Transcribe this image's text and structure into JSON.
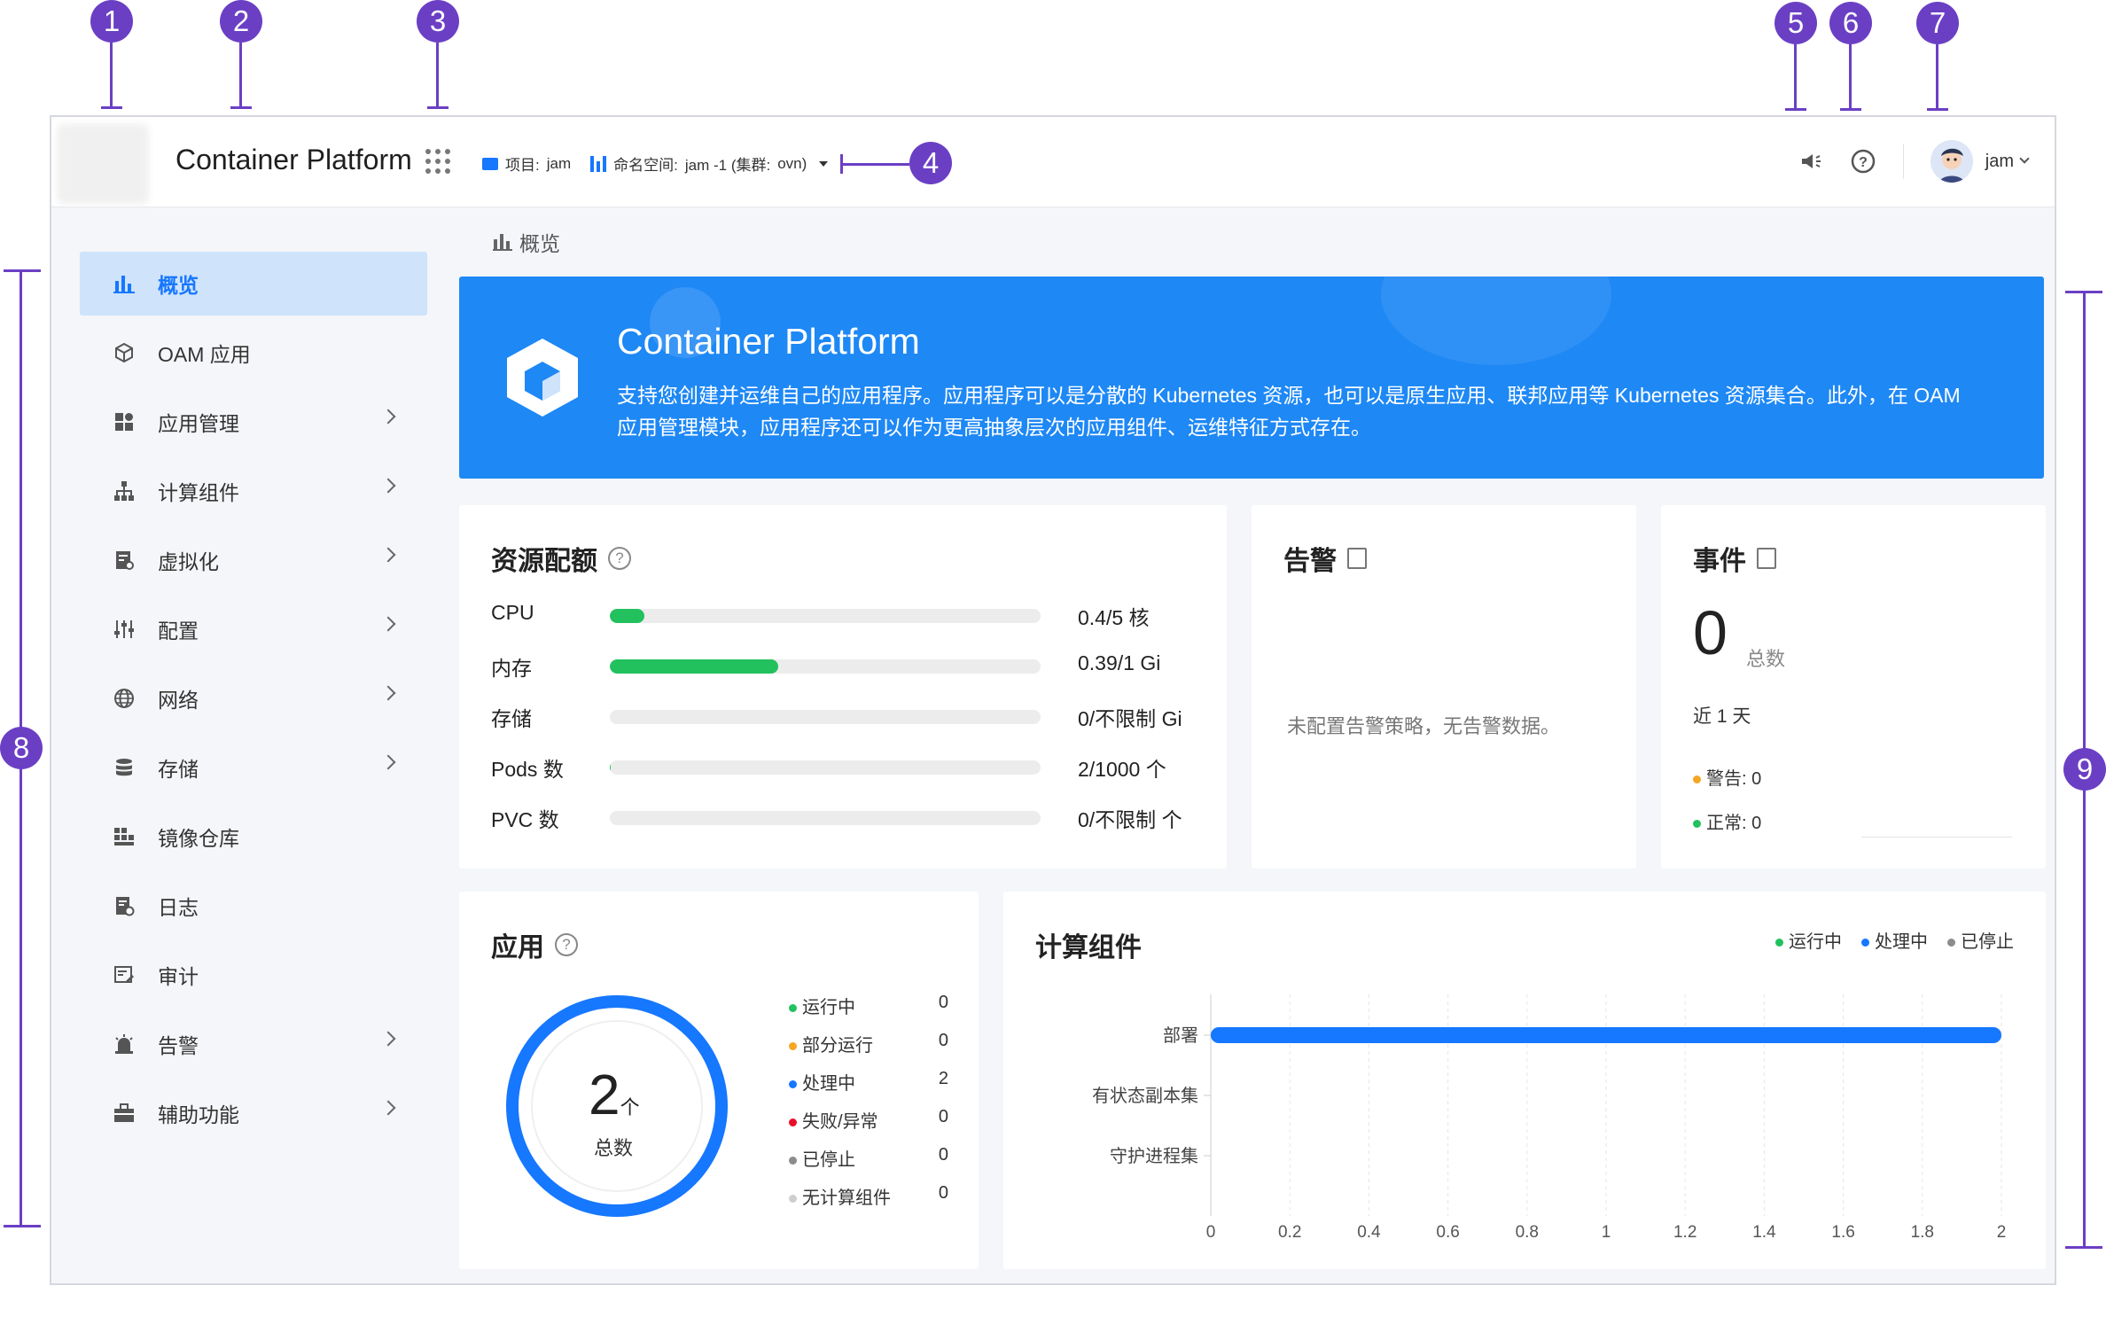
{
  "annotations": [
    "1",
    "2",
    "3",
    "4",
    "5",
    "6",
    "7",
    "8",
    "9"
  ],
  "header": {
    "brand": "Container Platform",
    "project_label": "项目:",
    "project_value": "jam",
    "namespace_label": "命名空间:",
    "namespace_value": "jam -1 (集群:",
    "cluster_value": "ovn)",
    "user": "jam"
  },
  "sidebar": {
    "items": [
      {
        "label": "概览",
        "icon": "chart-bar-icon"
      },
      {
        "label": "OAM 应用",
        "icon": "cube-icon"
      },
      {
        "label": "应用管理",
        "icon": "apps-icon"
      },
      {
        "label": "计算组件",
        "icon": "hierarchy-icon"
      },
      {
        "label": "虚拟化",
        "icon": "virtual-icon"
      },
      {
        "label": "配置",
        "icon": "sliders-icon"
      },
      {
        "label": "网络",
        "icon": "globe-icon"
      },
      {
        "label": "存储",
        "icon": "database-icon"
      },
      {
        "label": "镜像仓库",
        "icon": "grid-icon"
      },
      {
        "label": "日志",
        "icon": "log-icon"
      },
      {
        "label": "审计",
        "icon": "audit-icon"
      },
      {
        "label": "告警",
        "icon": "alarm-icon"
      },
      {
        "label": "辅助功能",
        "icon": "toolbox-icon"
      }
    ]
  },
  "breadcrumb": "概览",
  "banner": {
    "title": "Container Platform",
    "desc": "支持您创建并运维自己的应用程序。应用程序可以是分散的 Kubernetes 资源，也可以是原生应用、联邦应用等 Kubernetes 资源集合。此外，在 OAM 应用管理模块，应用程序还可以作为更高抽象层次的应用组件、运维特征方式存在。"
  },
  "quota": {
    "title": "资源配额",
    "rows": [
      {
        "label": "CPU",
        "value": "0.4/5 核",
        "fraction": 0.08
      },
      {
        "label": "内存",
        "value": "0.39/1 Gi",
        "fraction": 0.39
      },
      {
        "label": "存储",
        "value": "0/不限制 Gi",
        "fraction": 0
      },
      {
        "label": "Pods 数",
        "value": "2/1000 个",
        "fraction": 0.002
      },
      {
        "label": "PVC 数",
        "value": "0/不限制 个",
        "fraction": 0
      }
    ]
  },
  "alerts": {
    "title": "告警",
    "empty": "未配置告警策略，无告警数据。"
  },
  "events": {
    "title": "事件",
    "total": "0",
    "total_label": "总数",
    "period": "近 1 天",
    "warning": "警告: 0",
    "normal": "正常: 0"
  },
  "apps": {
    "title": "应用",
    "total": "2",
    "unit": "个",
    "total_label": "总数",
    "legend": [
      {
        "label": "运行中",
        "count": "0",
        "color": "#22c15e"
      },
      {
        "label": "部分运行",
        "count": "0",
        "color": "#f5a623"
      },
      {
        "label": "处理中",
        "count": "2",
        "color": "#1677ff"
      },
      {
        "label": "失败/异常",
        "count": "0",
        "color": "#e8102b"
      },
      {
        "label": "已停止",
        "count": "0",
        "color": "#8c8c8c"
      },
      {
        "label": "无计算组件",
        "count": "0",
        "color": "#cfcfcf"
      }
    ]
  },
  "workloads": {
    "title": "计算组件",
    "legend": [
      {
        "label": "运行中",
        "color": "#22c15e"
      },
      {
        "label": "处理中",
        "color": "#1677ff"
      },
      {
        "label": "已停止",
        "color": "#8c8c8c"
      }
    ]
  },
  "chart_data": {
    "type": "bar",
    "orientation": "horizontal",
    "categories": [
      "部署",
      "有状态副本集",
      "守护进程集"
    ],
    "series": [
      {
        "name": "处理中",
        "values": [
          2,
          0,
          0
        ],
        "color": "#1677ff"
      }
    ],
    "xticks": [
      "0",
      "0.2",
      "0.4",
      "0.6",
      "0.8",
      "1",
      "1.2",
      "1.4",
      "1.6",
      "1.8",
      "2"
    ],
    "xlim": [
      0,
      2
    ],
    "grid": true
  }
}
